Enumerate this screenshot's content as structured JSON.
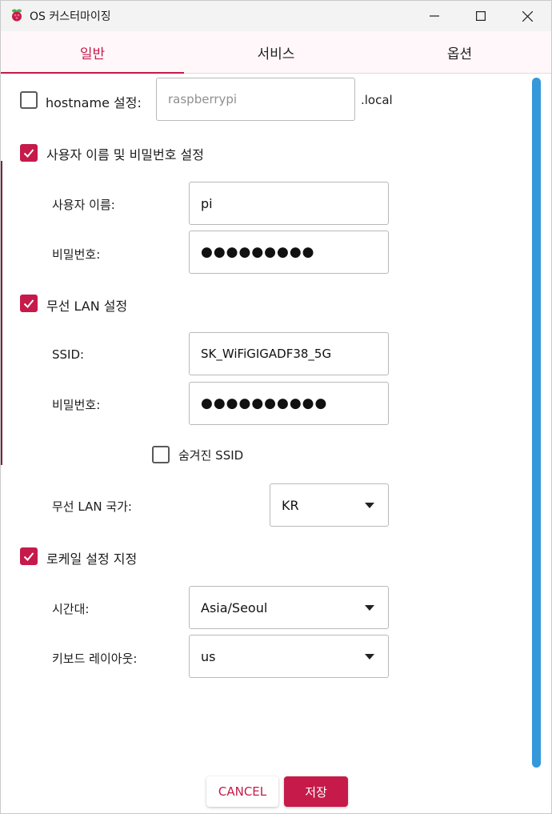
{
  "window": {
    "title": "OS 커스터마이징"
  },
  "tabs": [
    {
      "label": "일반",
      "active": true
    },
    {
      "label": "서비스",
      "active": false
    },
    {
      "label": "옵션",
      "active": false
    }
  ],
  "hostname": {
    "label": "hostname 설정:",
    "checked": false,
    "placeholder": "raspberrypi",
    "suffix": ".local"
  },
  "user": {
    "label": "사용자 이름 및 비밀번호 설정",
    "checked": true,
    "username_label": "사용자 이름:",
    "username_value": "pi",
    "password_label": "비밀번호:",
    "password_value": "●●●●●●●●●"
  },
  "wifi": {
    "label": "무선 LAN 설정",
    "checked": true,
    "ssid_label": "SSID:",
    "ssid_value": "SK_WiFiGIGADF38_5G",
    "password_label": "비밀번호:",
    "password_value": "●●●●●●●●●●",
    "hidden_label": "숨겨진 SSID",
    "hidden_checked": false,
    "country_label": "무선 LAN 국가:",
    "country_value": "KR"
  },
  "locale": {
    "label": "로케일 설정 지정",
    "checked": true,
    "timezone_label": "시간대:",
    "timezone_value": "Asia/Seoul",
    "keyboard_label": "키보드 레이아웃:",
    "keyboard_value": "us"
  },
  "buttons": {
    "cancel": "CANCEL",
    "save": "저장"
  },
  "colors": {
    "accent": "#c51a4a",
    "scrollbar": "#3498db"
  }
}
